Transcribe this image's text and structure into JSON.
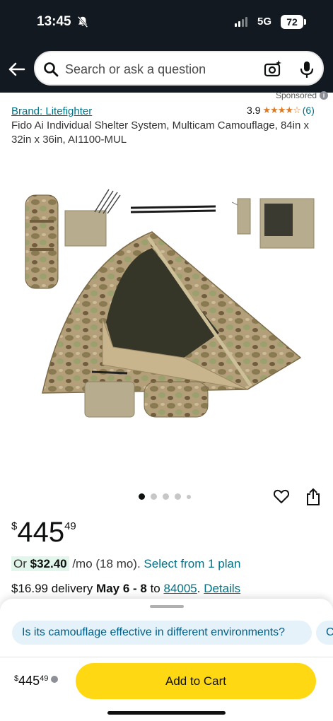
{
  "status_bar": {
    "time": "13:45",
    "network": "5G",
    "battery": "72"
  },
  "search": {
    "placeholder": "Search or ask a question"
  },
  "sponsored_label": "Sponsored",
  "product": {
    "brand": "Brand: Litefighter",
    "rating": "3.9",
    "rating_count": "(6)",
    "title": "Fido Ai Individual Shelter System, Multicam Camouflage, 84in x 32in x 36in, AI1100-MUL",
    "image_count": 5,
    "active_image": 1
  },
  "price": {
    "symbol": "$",
    "whole": "445",
    "fraction": "49"
  },
  "monthly": {
    "prefix": "Or ",
    "amount": "$32.40",
    "term": " /mo (18 mo). ",
    "link": "Select from 1 plan"
  },
  "delivery": {
    "cost": "$16.99 delivery ",
    "dates": "May 6 - 8",
    "to": " to ",
    "zip": "84005",
    "sep": ". ",
    "details": "Details"
  },
  "bottom_sheet": {
    "chip1": "Is its camouflage effective in different environments?",
    "chip2": "C",
    "price_symbol": "$",
    "price_whole": "445",
    "price_fraction": "49",
    "add_to_cart": "Add to Cart"
  },
  "colors": {
    "header_bg": "#131921",
    "link": "#007185",
    "cart_button": "#ffd814",
    "star": "#de7921"
  }
}
